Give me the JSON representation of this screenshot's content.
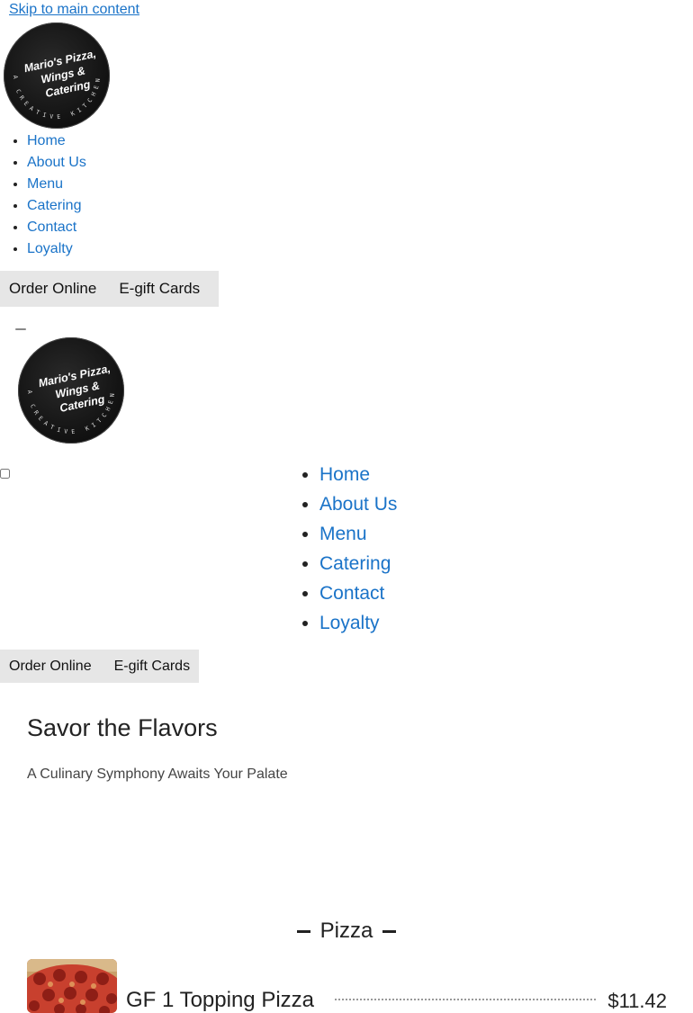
{
  "skip_link": "Skip to main content",
  "brand": {
    "logo_lines": [
      "Mario's Pizza,",
      "Wings &",
      "Catering"
    ],
    "logo_ring": "A CREATIVE KITCHEN"
  },
  "nav": {
    "items": [
      {
        "label": "Home"
      },
      {
        "label": "About Us"
      },
      {
        "label": "Menu"
      },
      {
        "label": "Catering"
      },
      {
        "label": "Contact"
      },
      {
        "label": "Loyalty"
      }
    ]
  },
  "actions": {
    "order_online": "Order Online",
    "egift_cards": "E-gift Cards"
  },
  "hero": {
    "title": "Savor the Flavors",
    "subtitle": "A Culinary Symphony Awaits Your Palate"
  },
  "menu_section": {
    "title": "Pizza",
    "items": [
      {
        "name": "GF 1 Topping Pizza",
        "price": "$11.42"
      }
    ]
  },
  "colors": {
    "link": "#1a73c8",
    "button_bar": "#e6e6e6",
    "logo_bg": "#111111"
  }
}
